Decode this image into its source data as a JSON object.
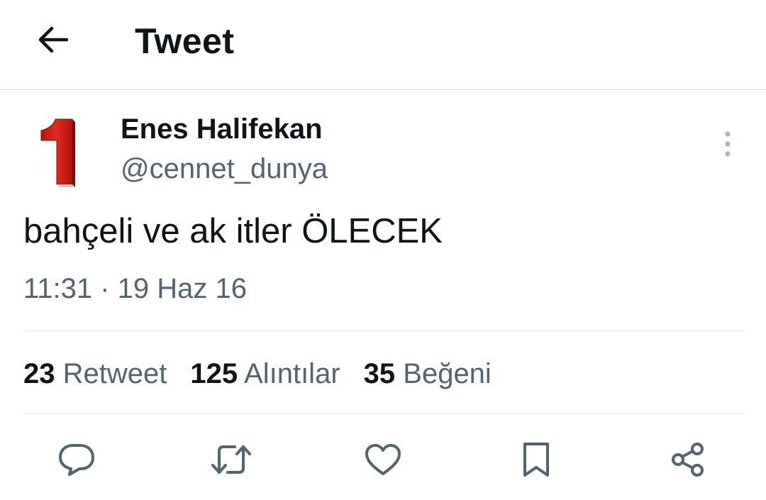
{
  "header": {
    "title": "Tweet",
    "back_icon": "back-arrow-icon"
  },
  "author": {
    "name": "Enes Halifekan",
    "handle": "@cennet_dunya",
    "avatar_glyph": "1",
    "avatar_color": "#d8241b"
  },
  "tweet": {
    "text": "bahçeli ve ak itler ÖLECEK",
    "meta": "11:31 · 19 Haz 16"
  },
  "stats": [
    {
      "count": "23",
      "label": "Retweet"
    },
    {
      "count": "125",
      "label": "Alıntılar"
    },
    {
      "count": "35",
      "label": "Beğeni"
    }
  ],
  "actions": [
    {
      "name": "reply",
      "icon": "reply-icon"
    },
    {
      "name": "retweet",
      "icon": "retweet-icon"
    },
    {
      "name": "like",
      "icon": "heart-icon"
    },
    {
      "name": "bookmark",
      "icon": "bookmark-icon"
    },
    {
      "name": "share",
      "icon": "share-icon"
    }
  ],
  "colors": {
    "text": "#0f1419",
    "secondary": "#536471",
    "divider": "#dfe3e6"
  }
}
